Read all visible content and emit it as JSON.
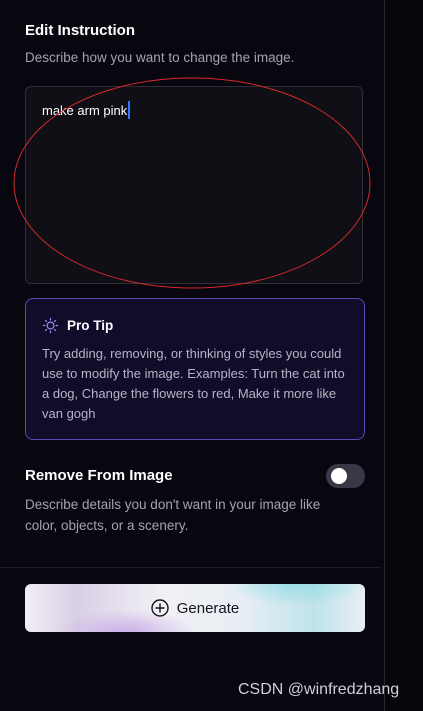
{
  "edit_instruction": {
    "title": "Edit Instruction",
    "description": "Describe how you want to change the image.",
    "input_value": "make arm pink"
  },
  "pro_tip": {
    "icon": "lightbulb-icon",
    "title": "Pro Tip",
    "body": "Try adding, removing, or thinking of styles you could use to modify the image. Examples: Turn the cat into a dog, Change the flowers to red, Make it more like van gogh"
  },
  "remove_from_image": {
    "title": "Remove From Image",
    "toggle_on": false,
    "description": "Describe details you don't want in your image like color, objects, or a scenery."
  },
  "generate": {
    "icon": "plus-circle-icon",
    "label": "Generate"
  },
  "watermark": "CSDN @winfredzhang",
  "colors": {
    "background": "#07060d",
    "tip_border": "#5b47b5",
    "tip_background": "#110c2a",
    "annotation": "#d42a2a",
    "caret": "#2f7bff"
  }
}
